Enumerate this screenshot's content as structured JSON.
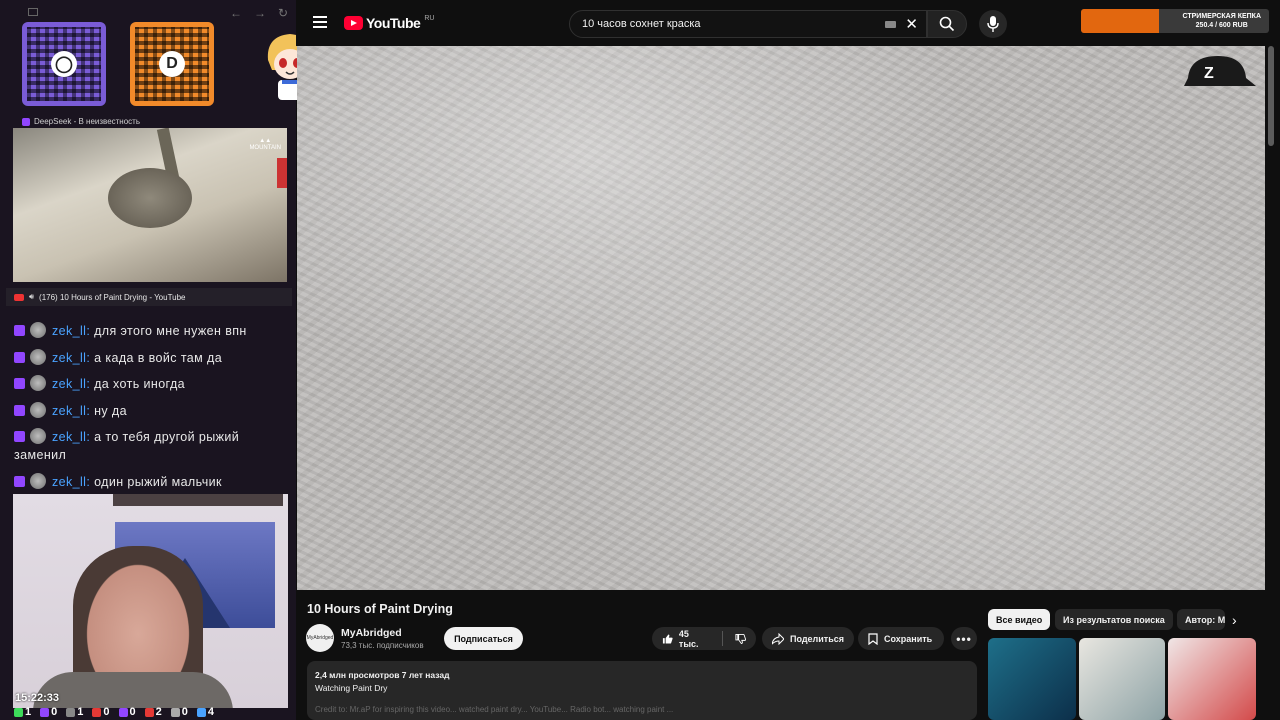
{
  "stream": {
    "qr_left_logo": "◯",
    "qr_right_logo": "D",
    "source_label": "DeepSeek - В неизвестность",
    "now_playing": "(176) 10 Hours of Paint Drying - YouTube",
    "time": "15:22:33",
    "stats": [
      {
        "value": "1",
        "color": "#3ddc5a"
      },
      {
        "value": "0",
        "color": "#9146ff"
      },
      {
        "value": "1",
        "color": "#888888"
      },
      {
        "value": "0",
        "color": "#e53935"
      },
      {
        "value": "0",
        "color": "#9146ff"
      },
      {
        "value": "2",
        "color": "#e53935"
      },
      {
        "value": "0",
        "color": "#aaaaaa"
      },
      {
        "value": "4",
        "color": "#4aa3ff"
      }
    ]
  },
  "chat": [
    {
      "user": "zek_ll:",
      "text": " для этого мне нужен впн"
    },
    {
      "user": "zek_ll:",
      "text": " а када в войс там да"
    },
    {
      "user": "zek_ll:",
      "text": " да хоть иногда"
    },
    {
      "user": "zek_ll:",
      "text": " ну да"
    },
    {
      "user": "zek_ll:",
      "text": " а то тебя другой рыжий заменил"
    },
    {
      "user": "zek_ll:",
      "text": " один рыжий мальчик"
    }
  ],
  "youtube": {
    "logo": "YouTube",
    "region": "RU",
    "search_value": "10 часов сохнет краска",
    "donation": {
      "label": "СТРИМЕРСКАЯ КЕПКА",
      "progress": "250.4 / 600 RUB",
      "fraction": 0.417
    },
    "cap_letter": "Z"
  },
  "video": {
    "title": "10 Hours of Paint Drying",
    "channel": "MyAbridged",
    "channel_avatar_text": "MyAbridged",
    "subscribers": "73,3 тыс. подписчиков",
    "subscribe": "Подписаться",
    "likes": "45 тыс.",
    "share": "Поделиться",
    "save": "Сохранить",
    "more": "•••",
    "views_line": "2,4 млн просмотров  7 лет назад",
    "desc_line": "Watching Paint Dry",
    "desc_blur": "Credit to: Mr.aP for inspiring this video... watched paint dry... YouTube... Radio bot... watching paint ..."
  },
  "related": {
    "chips": [
      "Все видео",
      "Из результатов поиска",
      "Автор: MyAbridged"
    ],
    "next": "›"
  },
  "colors": {
    "youtube_red": "#ff0033",
    "twitch_purple": "#9146ff",
    "donation_orange": "#e2670f",
    "chat_username": "#4aa3ff"
  }
}
